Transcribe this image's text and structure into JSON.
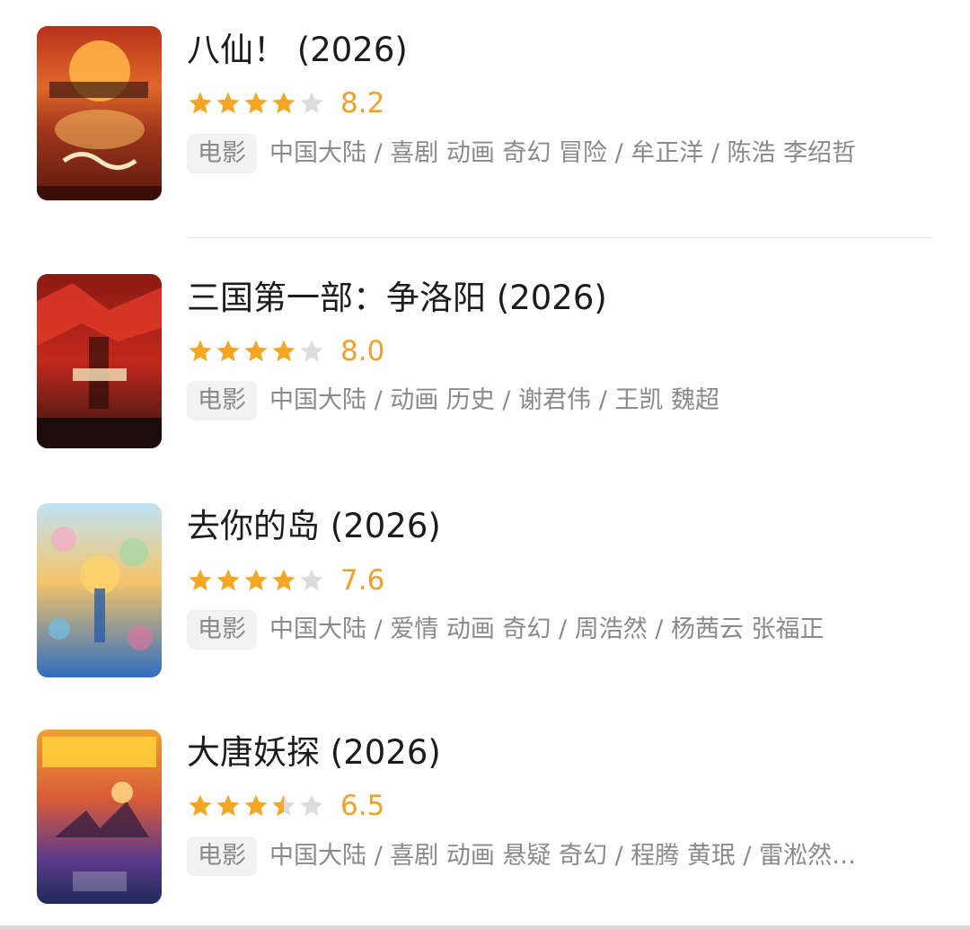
{
  "movies": [
    {
      "title": "八仙！ (2026)",
      "score": "8.2",
      "stars": 4,
      "half": false,
      "tag": "电影",
      "meta": "中国大陆 / 喜剧 动画 奇幻 冒险 / 牟正洋 / 陈浩 李绍哲"
    },
    {
      "title": "三国第一部：争洛阳 (2026)",
      "score": "8.0",
      "stars": 4,
      "half": false,
      "tag": "电影",
      "meta": "中国大陆 / 动画 历史 / 谢君伟 / 王凯 魏超"
    },
    {
      "title": "去你的岛 (2026)",
      "score": "7.6",
      "stars": 4,
      "half": false,
      "tag": "电影",
      "meta": "中国大陆 / 爱情 动画 奇幻 / 周浩然 / 杨茜云 张福正"
    },
    {
      "title": "大唐妖探 (2026)",
      "score": "6.5",
      "stars": 3,
      "half": true,
      "tag": "电影",
      "meta": "中国大陆 / 喜剧 动画 悬疑 奇幻 / 程腾 黄珉 / 雷淞然…"
    }
  ],
  "colors": {
    "star_filled": "#f5a623",
    "star_empty": "#dcdcdc",
    "score": "#f0a12b"
  }
}
